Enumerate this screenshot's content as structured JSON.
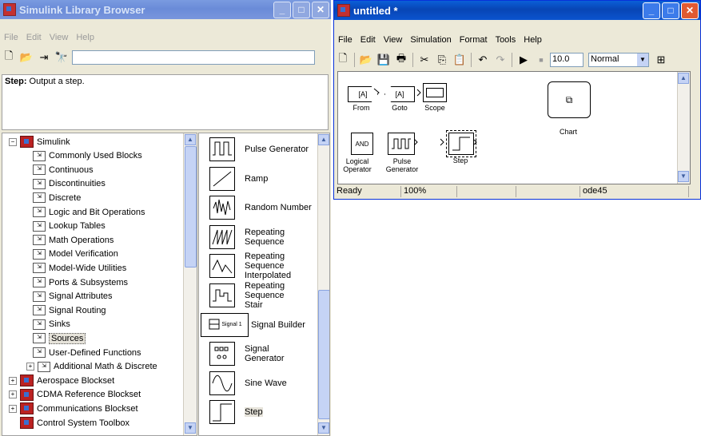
{
  "library_browser": {
    "title": "Simulink Library Browser",
    "menu": [
      "File",
      "Edit",
      "View",
      "Help"
    ],
    "description_label": "Step:",
    "description_text": " Output a step.",
    "tree": [
      {
        "label": "Simulink",
        "level": 0,
        "type": "root",
        "expander": "−"
      },
      {
        "label": "Commonly Used Blocks",
        "level": 1
      },
      {
        "label": "Continuous",
        "level": 1
      },
      {
        "label": "Discontinuities",
        "level": 1
      },
      {
        "label": "Discrete",
        "level": 1
      },
      {
        "label": "Logic and Bit Operations",
        "level": 1
      },
      {
        "label": "Lookup Tables",
        "level": 1
      },
      {
        "label": "Math Operations",
        "level": 1
      },
      {
        "label": "Model Verification",
        "level": 1
      },
      {
        "label": "Model-Wide Utilities",
        "level": 1
      },
      {
        "label": "Ports & Subsystems",
        "level": 1
      },
      {
        "label": "Signal Attributes",
        "level": 1
      },
      {
        "label": "Signal Routing",
        "level": 1
      },
      {
        "label": "Sinks",
        "level": 1
      },
      {
        "label": "Sources",
        "level": 1,
        "selected": true
      },
      {
        "label": "User-Defined Functions",
        "level": 1
      },
      {
        "label": "Additional Math & Discrete",
        "level": 1,
        "expander": "+"
      },
      {
        "label": "Aerospace Blockset",
        "level": 0,
        "type": "root",
        "expander": "+"
      },
      {
        "label": "CDMA Reference Blockset",
        "level": 0,
        "type": "root",
        "expander": "+"
      },
      {
        "label": "Communications Blockset",
        "level": 0,
        "type": "root",
        "expander": "+"
      },
      {
        "label": "Control System Toolbox",
        "level": 0,
        "type": "root"
      }
    ],
    "blocks": [
      {
        "label": "Pulse Generator",
        "icon": "pulse-generator-icon"
      },
      {
        "label": "Ramp",
        "icon": "ramp-icon"
      },
      {
        "label": "Random Number",
        "icon": "random-number-icon"
      },
      {
        "label": "Repeating Sequence",
        "icon": "repeating-sequence-icon"
      },
      {
        "label": "Repeating Sequence Interpolated",
        "icon": "repeating-sequence-interpolated-icon"
      },
      {
        "label": "Repeating Sequence Stair",
        "icon": "repeating-sequence-stair-icon"
      },
      {
        "label": "Signal Builder",
        "icon": "signal-builder-icon",
        "icon_text": "Signal 1"
      },
      {
        "label": "Signal Generator",
        "icon": "signal-generator-icon"
      },
      {
        "label": "Sine Wave",
        "icon": "sine-wave-icon"
      },
      {
        "label": "Step",
        "icon": "step-icon",
        "selected": true
      }
    ]
  },
  "model": {
    "title": "untitled *",
    "menu": [
      "File",
      "Edit",
      "View",
      "Simulation",
      "Format",
      "Tools",
      "Help"
    ],
    "stop_time": "10.0",
    "sim_mode": "Normal",
    "blocks": {
      "from_tag": "[A]",
      "from_label": "From",
      "goto_tag": "[A]",
      "goto_label": "Goto",
      "scope_label": "Scope",
      "chart_label": "Chart",
      "logical_text": "AND",
      "logical_label": "Logical\nOperator",
      "pulse_label": "Pulse\nGenerator",
      "step_label": "Step"
    },
    "status": {
      "state": "Ready",
      "zoom": "100%",
      "solver": "ode45"
    }
  }
}
